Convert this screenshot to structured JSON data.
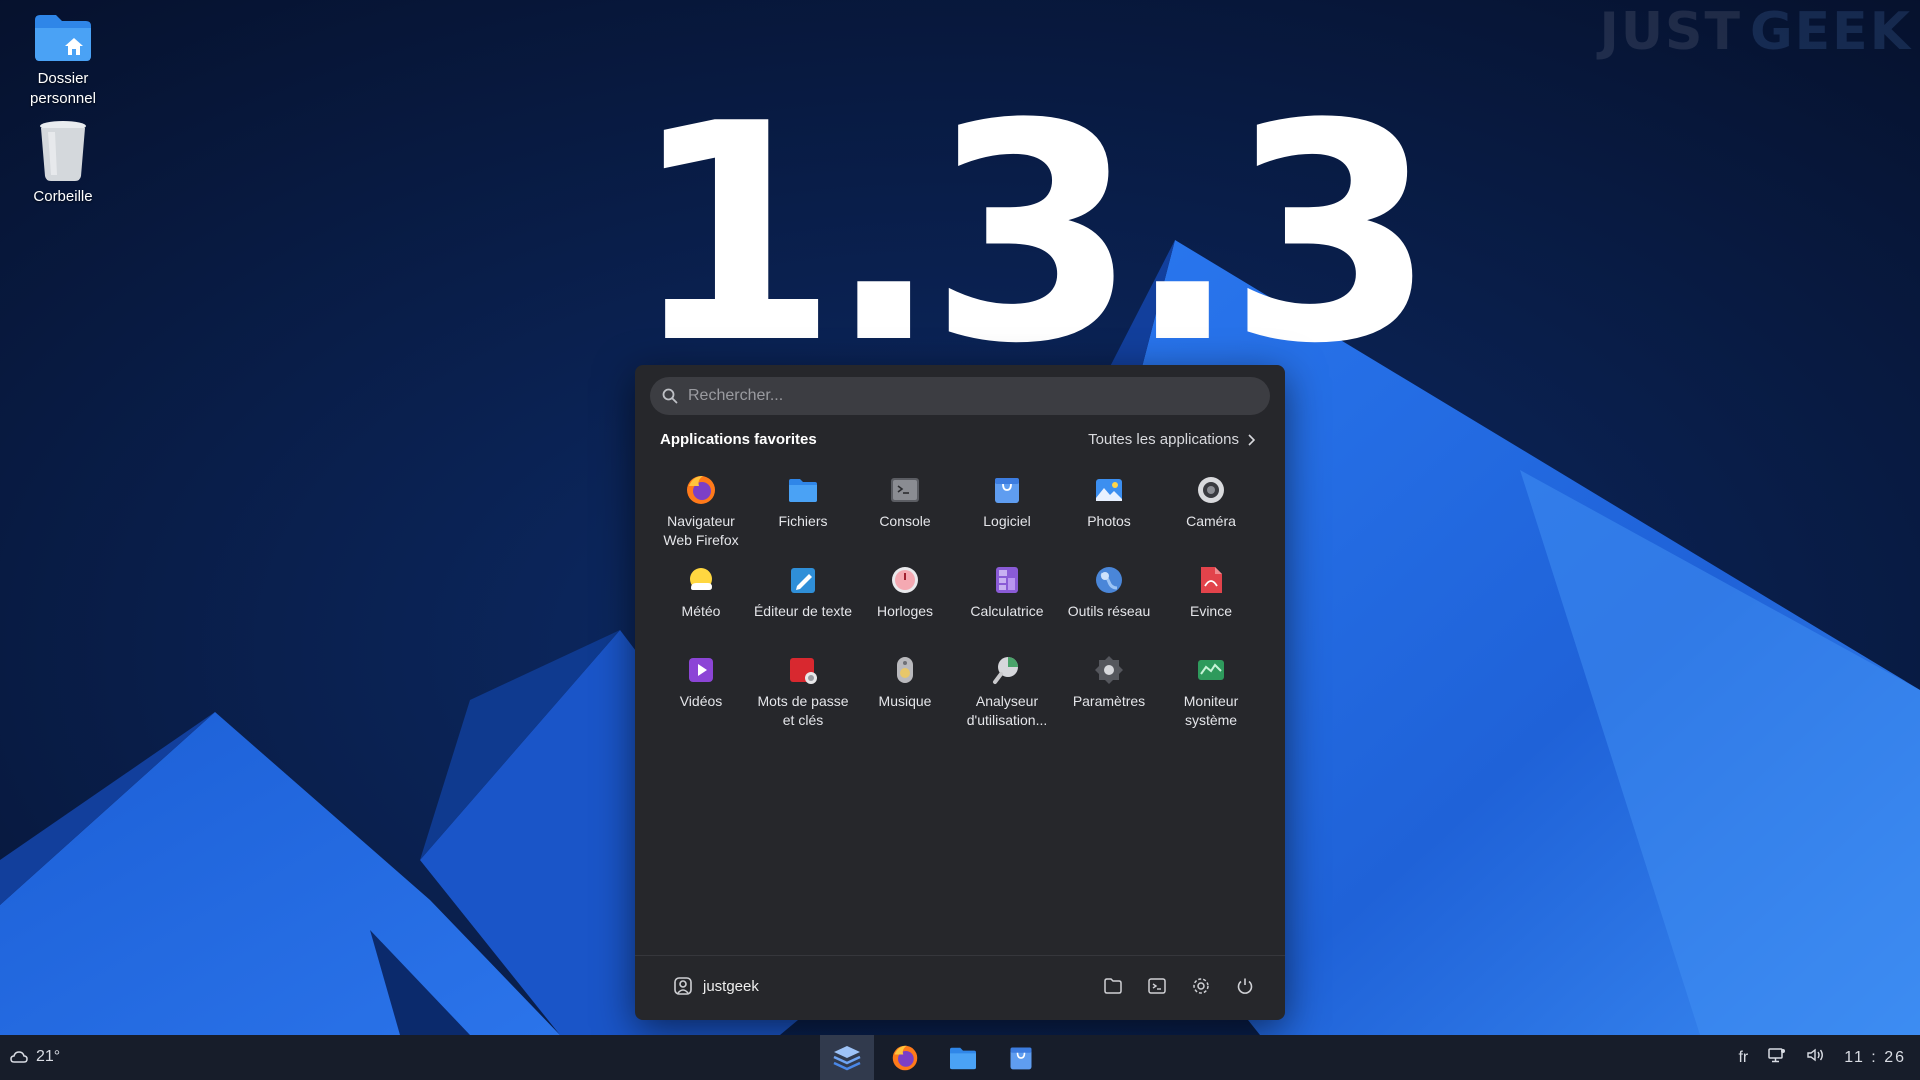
{
  "watermark": {
    "part1": "JUST",
    "part2": "GEEK"
  },
  "hero_text": "1.3.3",
  "desktop": {
    "icons": [
      {
        "label": "Dossier personnel",
        "icon": "home-folder-icon"
      },
      {
        "label": "Corbeille",
        "icon": "trash-icon"
      }
    ]
  },
  "menu": {
    "search": {
      "placeholder": "Rechercher..."
    },
    "section_title": "Applications favorites",
    "all_apps_label": "Toutes les applications",
    "apps": [
      {
        "label": "Navigateur Web Firefox",
        "icon": "firefox-icon"
      },
      {
        "label": "Fichiers",
        "icon": "files-icon"
      },
      {
        "label": "Console",
        "icon": "console-icon"
      },
      {
        "label": "Logiciel",
        "icon": "software-store-icon"
      },
      {
        "label": "Photos",
        "icon": "photos-icon"
      },
      {
        "label": "Caméra",
        "icon": "camera-icon"
      },
      {
        "label": "Météo",
        "icon": "weather-icon"
      },
      {
        "label": "Éditeur de texte",
        "icon": "text-editor-icon"
      },
      {
        "label": "Horloges",
        "icon": "clocks-icon"
      },
      {
        "label": "Calculatrice",
        "icon": "calculator-icon"
      },
      {
        "label": "Outils réseau",
        "icon": "network-tools-icon"
      },
      {
        "label": "Evince",
        "icon": "document-viewer-icon"
      },
      {
        "label": "Vidéos",
        "icon": "videos-icon"
      },
      {
        "label": "Mots de passe et clés",
        "icon": "passwords-icon"
      },
      {
        "label": "Musique",
        "icon": "music-icon"
      },
      {
        "label": "Analyseur d'utilisation...",
        "icon": "disk-usage-icon"
      },
      {
        "label": "Paramètres",
        "icon": "settings-icon"
      },
      {
        "label": "Moniteur système",
        "icon": "system-monitor-icon"
      }
    ],
    "user": {
      "name": "justgeek",
      "icon": "user-avatar-icon"
    },
    "footer_icons": [
      "folder-icon",
      "terminal-icon",
      "gear-icon",
      "power-icon"
    ]
  },
  "taskbar": {
    "weather": {
      "icon": "cloud-icon",
      "temp": "21°"
    },
    "dock": [
      {
        "name": "app-launcher",
        "icon": "launcher-icon",
        "active": true
      },
      {
        "name": "firefox",
        "icon": "firefox-icon",
        "active": false
      },
      {
        "name": "files",
        "icon": "files-icon",
        "active": false
      },
      {
        "name": "software",
        "icon": "software-store-icon",
        "active": false
      }
    ],
    "tray": {
      "lang": "fr",
      "clock": "11 : 26"
    }
  },
  "colors": {
    "accent": "#2f7bf0",
    "menu_bg": "#26272b",
    "taskbar_bg": "#171d2a",
    "wallpaper_dark": "#071a3d"
  }
}
